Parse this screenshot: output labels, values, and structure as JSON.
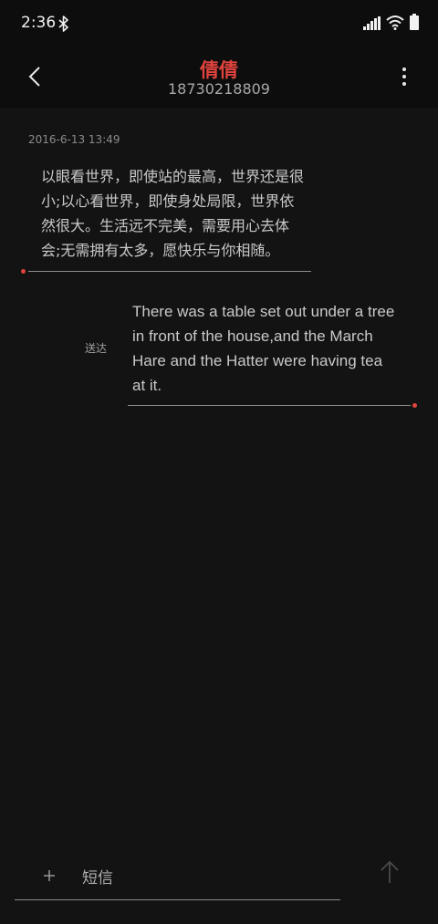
{
  "status_bar": {
    "time": "2:36",
    "icons": [
      "bluetooth-icon",
      "signal-icon",
      "wifi-icon",
      "battery-icon"
    ]
  },
  "header": {
    "contact_name": "倩倩",
    "contact_number": "18730218809",
    "back_icon": "chevron-left-icon",
    "more_icon": "more-vertical-icon"
  },
  "conversation": {
    "timestamp": "2016-6-13 13:49",
    "messages": [
      {
        "direction": "incoming",
        "lines": [
          "以眼看世界，即使站的最高，世界还是很",
          "小;以心看世界，即使身处局限，世界依",
          "然很大。生活远不完美，需要用心去体",
          "会;无需拥有太多，愿快乐与你相随。"
        ]
      },
      {
        "direction": "outgoing",
        "status": "送达",
        "lines": [
          "There was a table set out under a tree",
          "in front of the house,and the March",
          "Hare and the Hatter were having tea",
          "at it."
        ]
      }
    ]
  },
  "compose": {
    "attach_icon": "plus-icon",
    "placeholder": "短信",
    "send_icon": "arrow-up-icon"
  },
  "colors": {
    "background": "#131313",
    "bar_background": "#0d0d0d",
    "accent": "#e0433d",
    "text": "#c9c9c9",
    "muted": "#8a8a8a"
  }
}
